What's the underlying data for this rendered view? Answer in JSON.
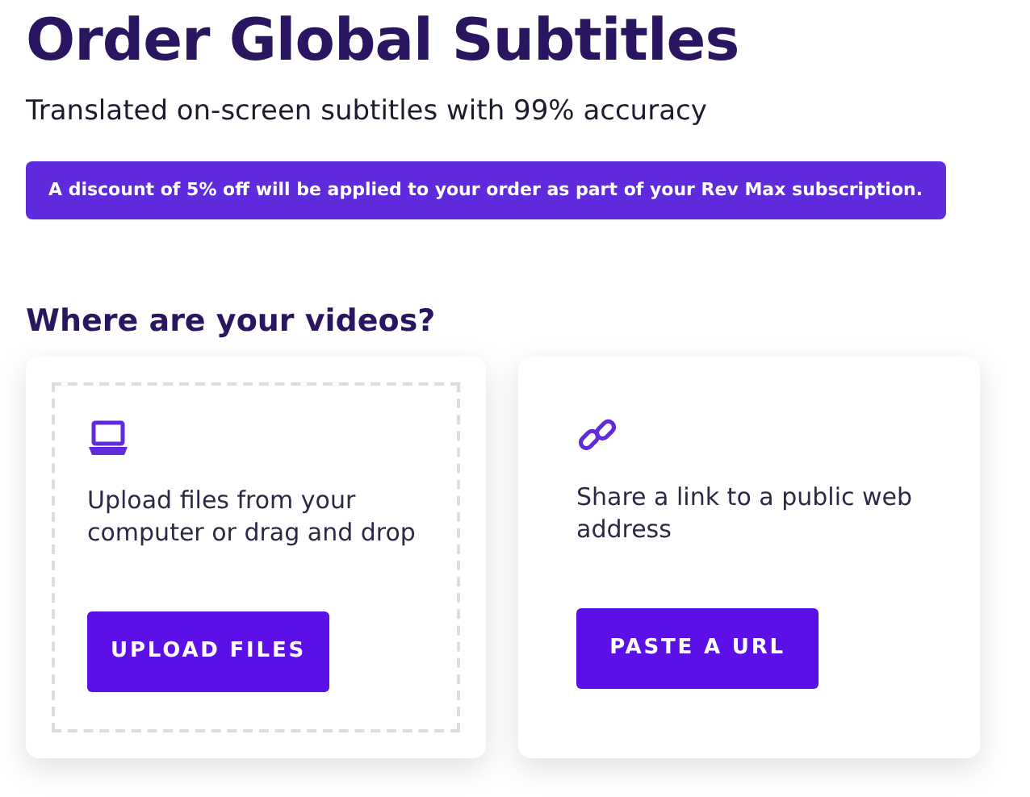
{
  "title": "Order Global Subtitles",
  "subtitle": "Translated on-screen subtitles with 99% accuracy",
  "discount_banner": "A discount of 5% off will be applied to your order as part of your Rev Max subscription.",
  "section_heading": "Where are your videos?",
  "sources": [
    {
      "kind": "upload",
      "description": "Upload files from your computer or drag and drop",
      "button": "UPLOAD FILES"
    },
    {
      "kind": "link",
      "description": "Share a link to a public web address",
      "button": "PASTE A URL"
    }
  ]
}
